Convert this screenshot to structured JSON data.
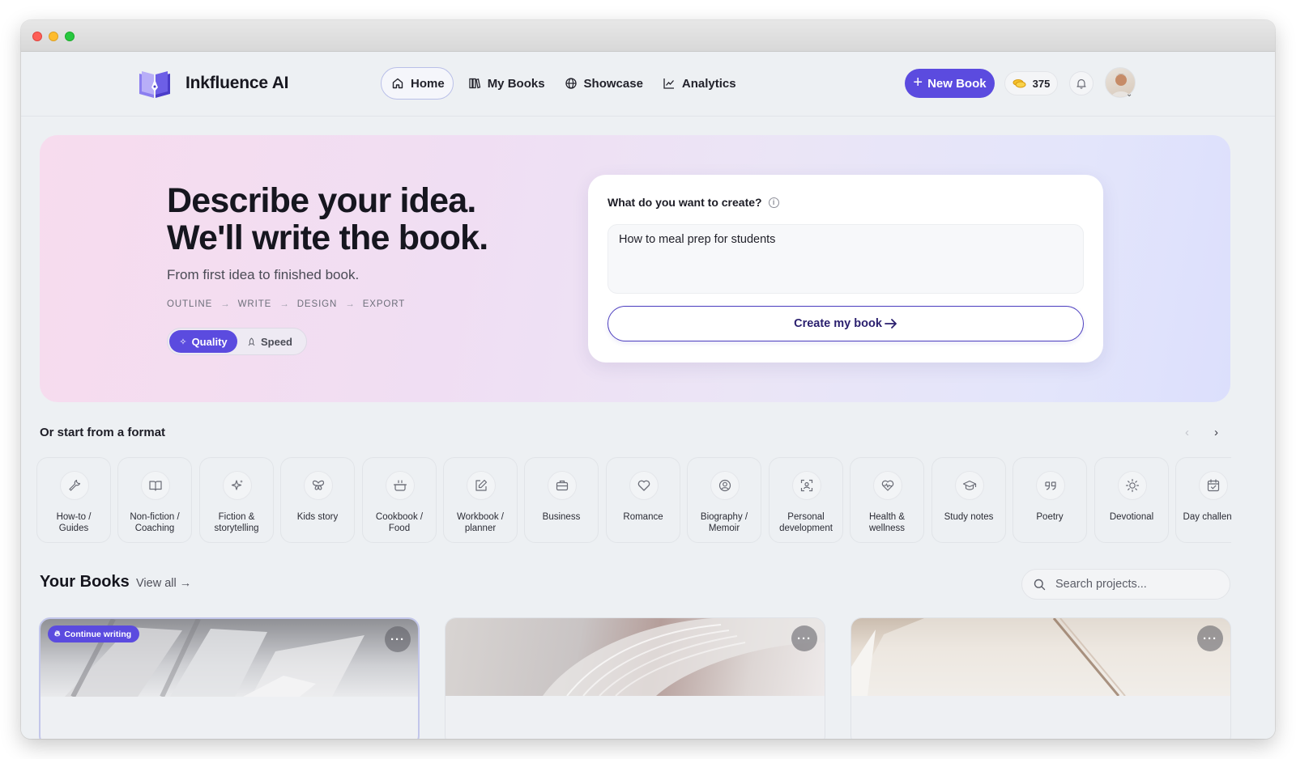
{
  "nav": {
    "brand": "Inkfluence AI",
    "links": [
      {
        "label": "Home",
        "icon": "home-icon"
      },
      {
        "label": "My Books",
        "icon": "books-icon"
      },
      {
        "label": "Showcase",
        "icon": "globe-icon"
      },
      {
        "label": "Analytics",
        "icon": "chart-line-icon"
      }
    ],
    "new_book_label": "New Book",
    "credits": "375"
  },
  "hero": {
    "title_line1": "Describe your idea.",
    "title_line2": "We'll write the book.",
    "subtitle": "From first idea to finished book.",
    "steps": [
      "OUTLINE",
      "WRITE",
      "DESIGN",
      "EXPORT"
    ],
    "step_arrow": "→",
    "modes": [
      {
        "label": "Quality",
        "selected": true
      },
      {
        "label": "Speed",
        "selected": false
      }
    ],
    "question": "What do you want to create?",
    "idea_value": "How to meal prep for students",
    "create_label": "Create my book"
  },
  "formats": {
    "title": "Or start from a format",
    "items": [
      {
        "label": "How-to /\nGuides",
        "icon": "wrench-icon"
      },
      {
        "label": "Non-fiction /\nCoaching",
        "icon": "open-book-icon"
      },
      {
        "label": "Fiction &\nstorytelling",
        "icon": "sparkles-icon"
      },
      {
        "label": "Kids story",
        "icon": "butterfly-icon"
      },
      {
        "label": "Cookbook /\nFood",
        "icon": "cooking-pot-icon"
      },
      {
        "label": "Workbook /\nplanner",
        "icon": "edit-icon"
      },
      {
        "label": "Business",
        "icon": "briefcase-icon"
      },
      {
        "label": "Romance",
        "icon": "heart-icon"
      },
      {
        "label": "Biography /\nMemoir",
        "icon": "user-circle-icon"
      },
      {
        "label": "Personal\ndevelopment",
        "icon": "focus-user-icon"
      },
      {
        "label": "Health &\nwellness",
        "icon": "heart-pulse-icon"
      },
      {
        "label": "Study notes",
        "icon": "graduation-cap-icon"
      },
      {
        "label": "Poetry",
        "icon": "quote-icon"
      },
      {
        "label": "Devotional",
        "icon": "sun-icon"
      },
      {
        "label": "Day challenge",
        "icon": "calendar-check-icon"
      }
    ]
  },
  "books": {
    "title": "Your Books",
    "view_all": "View all →",
    "search_placeholder": "Search projects...",
    "badge": "Continue writing",
    "more_label": "···"
  },
  "colors": {
    "accent": "#5b4bdf",
    "background": "#edf0f3"
  }
}
